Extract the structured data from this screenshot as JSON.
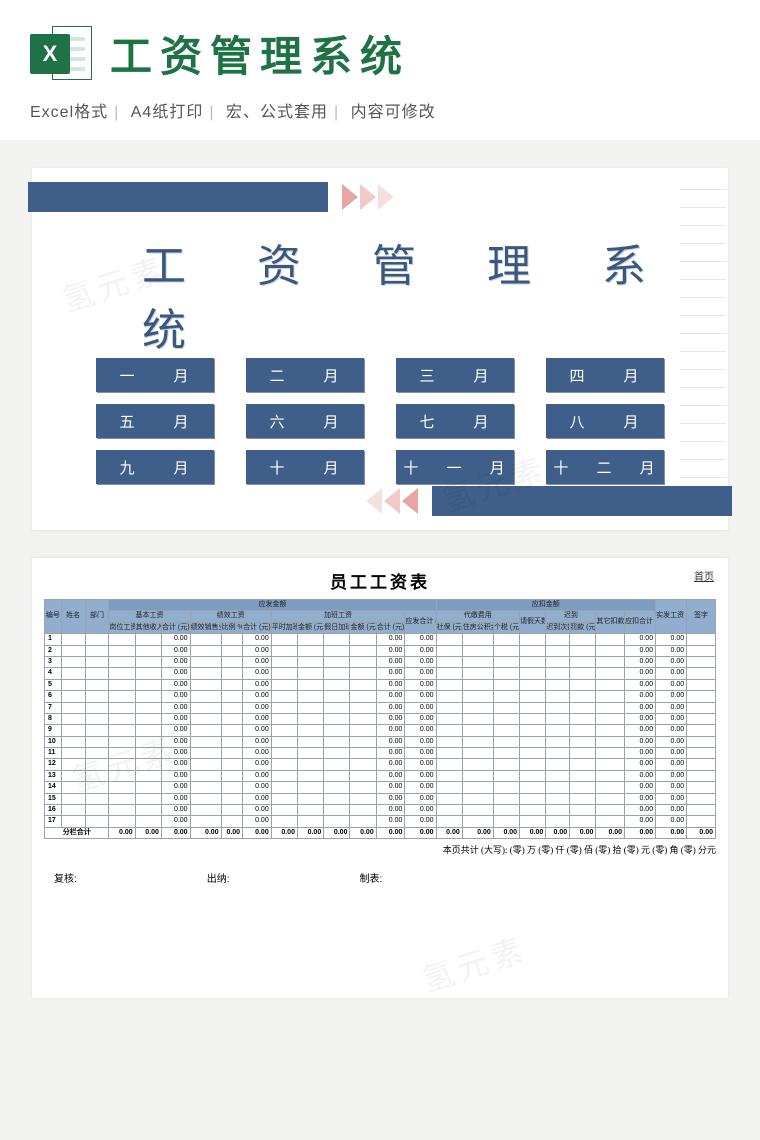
{
  "header": {
    "icon_letter": "X",
    "title": "工资管理系统"
  },
  "subheader": {
    "items": [
      "Excel格式",
      "A4纸打印",
      "宏、公式套用",
      "内容可修改"
    ]
  },
  "nav": {
    "title_line1": "工 资 管 理 系",
    "title_line2": "统",
    "months": [
      "一　月",
      "二　月",
      "三　月",
      "四　月",
      "五　月",
      "六　月",
      "七　月",
      "八　月",
      "九　月",
      "十　月",
      "十 一 月",
      "十 二 月"
    ]
  },
  "table": {
    "title": "员工工资表",
    "home": "首页",
    "group_pay": "应发金额",
    "group_deduct": "应扣金额",
    "sub_base": "基本工资",
    "sub_perf": "绩效工资",
    "sub_ot": "加班工资",
    "sub_agency": "代缴费用",
    "sub_late": "迟到",
    "cols": {
      "idx": "编号",
      "name": "姓名",
      "dept": "部门",
      "post_pay": "岗位工资",
      "other_in": "其他收入",
      "sub1": "合计 (元)",
      "perf_sale": "绩效销售业绩",
      "perf_pct": "比例 %",
      "perf_amt": "合计 (元)",
      "ot_hr": "平时加班工时",
      "ot_amt": "金额 (元)",
      "ot_hol_hr": "假日加班工时 (h)",
      "ot_hol_amt": "金额 (元)",
      "sub_ot": "合计 (元)",
      "gross": "应发合计 (元)",
      "soc": "社保 (元)",
      "fund": "住房公积金 (元)",
      "tax": "个税 (元)",
      "leave": "请假天数 (天)",
      "late_cnt": "迟到次数",
      "late_fine": "罚款 (元)",
      "other_dd": "其它扣款 (元)",
      "dd_sum": "应扣合计 (元)",
      "net": "实发工资 (元)",
      "sign": "签字"
    },
    "rows": 17,
    "zero": "0.00",
    "total_label": "分栏合计",
    "big_total": "本页共计 (大写): (零) 万 (零) 仟 (零) 佰 (零) 拾 (零) 元 (零) 角 (零) 分元",
    "sign_labels": [
      "复核:",
      "出纳:",
      "制表:"
    ]
  },
  "watermark": "氢元素"
}
